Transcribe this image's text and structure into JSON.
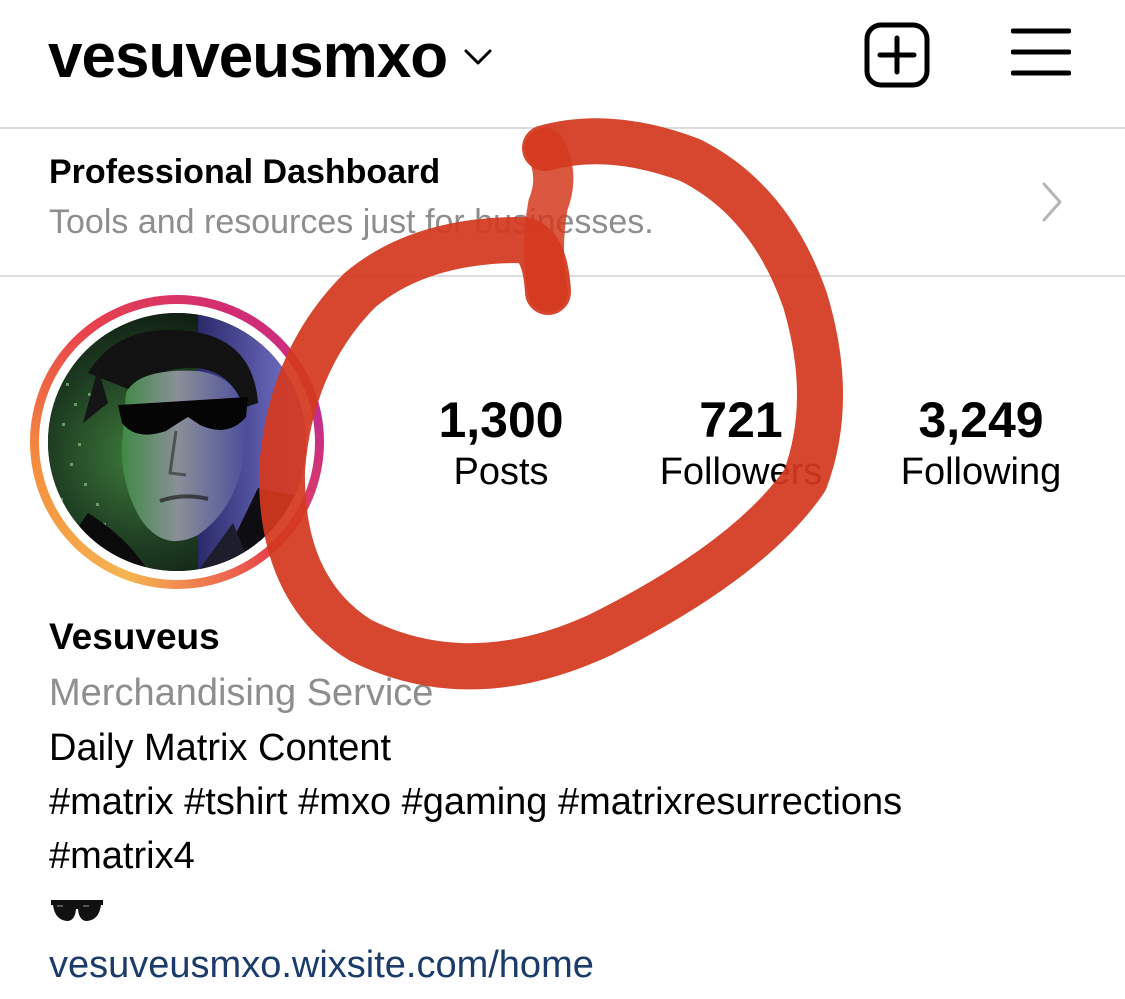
{
  "header": {
    "username": "vesuveusmxo",
    "icons": {
      "dropdown": "chevron-down-icon",
      "new_post": "plus-square-icon",
      "menu": "hamburger-menu-icon"
    }
  },
  "dashboard": {
    "title": "Professional Dashboard",
    "subtitle": "Tools and resources just for businesses.",
    "icon": "chevron-right-icon"
  },
  "profile": {
    "avatar_icon": "profile-avatar",
    "stats": {
      "posts": {
        "value": "1,300",
        "label": "Posts"
      },
      "followers": {
        "value": "721",
        "label": "Followers"
      },
      "following": {
        "value": "3,249",
        "label": "Following"
      }
    }
  },
  "bio": {
    "name": "Vesuveus",
    "category": "Merchandising Service",
    "line1": "Daily Matrix Content",
    "line2": "#matrix #tshirt #mxo #gaming #matrixresurrections",
    "line3": "#matrix4",
    "emoji": "sunglasses-emoji",
    "link": "vesuveusmxo.wixsite.com/home"
  },
  "colors": {
    "marker": "#d4391f",
    "link": "#1b3c6b",
    "muted": "#8e8e8e"
  }
}
